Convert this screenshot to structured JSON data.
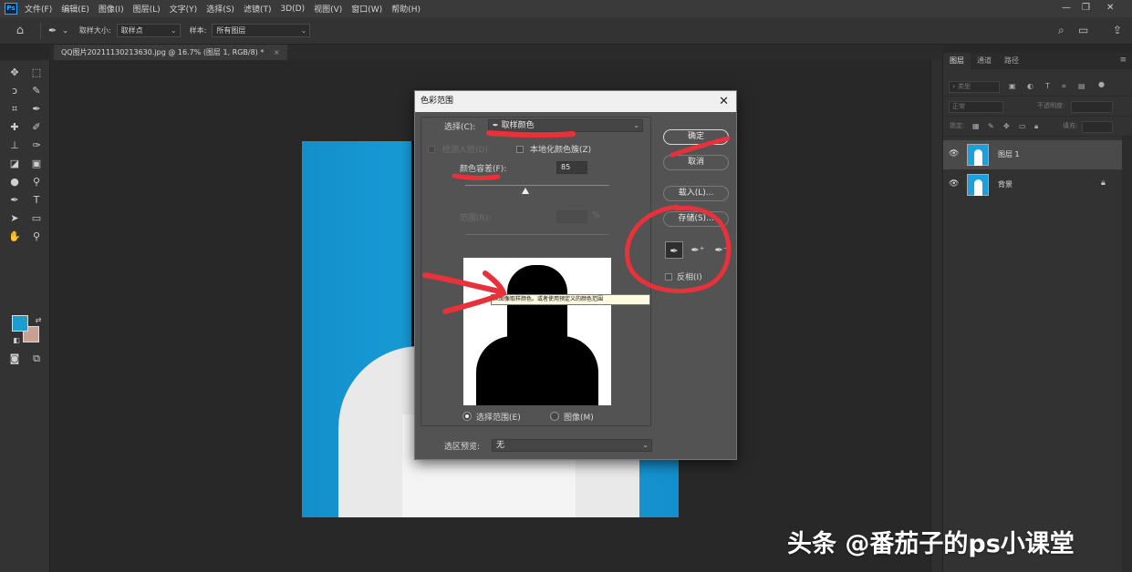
{
  "app": {
    "logo": "Ps"
  },
  "menu": [
    "文件(F)",
    "编辑(E)",
    "图像(I)",
    "图层(L)",
    "文字(Y)",
    "选择(S)",
    "滤镜(T)",
    "3D(D)",
    "视图(V)",
    "窗口(W)",
    "帮助(H)"
  ],
  "options": {
    "sample_size_label": "取样大小:",
    "sample_size_value": "取样点",
    "sample_label": "样本:",
    "sample_value": "所有图层"
  },
  "document": {
    "tab_title": "QQ图片20211130213630.jpg @ 16.7% (图层 1, RGB/8) *",
    "close": "×"
  },
  "layers_panel": {
    "tabs": [
      "图层",
      "通道",
      "路径"
    ],
    "search_placeholder": "类型",
    "blend_mode": "正常",
    "opacity_label": "不透明度:",
    "lock_label": "锁定:",
    "fill_label": "填充:",
    "layers": [
      {
        "name": "图层 1",
        "selected": true
      },
      {
        "name": "背景",
        "locked": true
      }
    ]
  },
  "dialog": {
    "title": "色彩范围",
    "select_label": "选择(C):",
    "select_value": "取样颜色",
    "detect_faces_label": "检测人脸(D)",
    "localized_label": "本地化颜色簇(Z)",
    "fuzziness_label": "颜色容差(F):",
    "fuzziness_value": "85",
    "fuzziness_percent": 0.42,
    "range_label": "范围(R):",
    "range_unit": "%",
    "radio_selection": "选择范围(E)",
    "radio_image": "图像(M)",
    "preview_label": "选区预览:",
    "preview_value": "无",
    "ok": "确定",
    "cancel": "取消",
    "load": "载入(L)...",
    "save": "存储(S)...",
    "invert": "反相(I)",
    "tooltip": "从图像取样颜色。或者使用预定义的颜色范围"
  },
  "watermark": "头条 @番茄子的ps小课堂",
  "colors": {
    "foreground": "#1e9bd0",
    "background": "#c9a092",
    "annotation": "#e8313a"
  }
}
